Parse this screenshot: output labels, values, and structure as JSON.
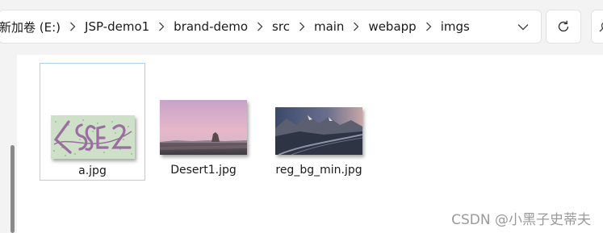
{
  "breadcrumb": {
    "items": [
      "新加卷 (E:)",
      "JSP-demo1",
      "brand-demo",
      "src",
      "main",
      "webapp",
      "imgs"
    ]
  },
  "icons": {
    "separator": "chevron-right-icon",
    "dropdown": "chevron-down-icon",
    "refresh": "refresh-icon",
    "search": "search-icon"
  },
  "files": [
    {
      "name": "a.jpg",
      "selected": true,
      "thumbnail": "captcha image with distorted letters"
    },
    {
      "name": "Desert1.jpg",
      "selected": false,
      "thumbnail": "pink-purple desert sky with rock formation"
    },
    {
      "name": "reg_bg_min.jpg",
      "selected": false,
      "thumbnail": "mountain valley road at dusk"
    }
  ],
  "watermark": "CSDN @小黑子史蒂夫",
  "colors": {
    "selection_border": "#a8d3ef",
    "scroll_thumb": "#8a8a8a",
    "chrome_bg": "#f3f3f3"
  }
}
